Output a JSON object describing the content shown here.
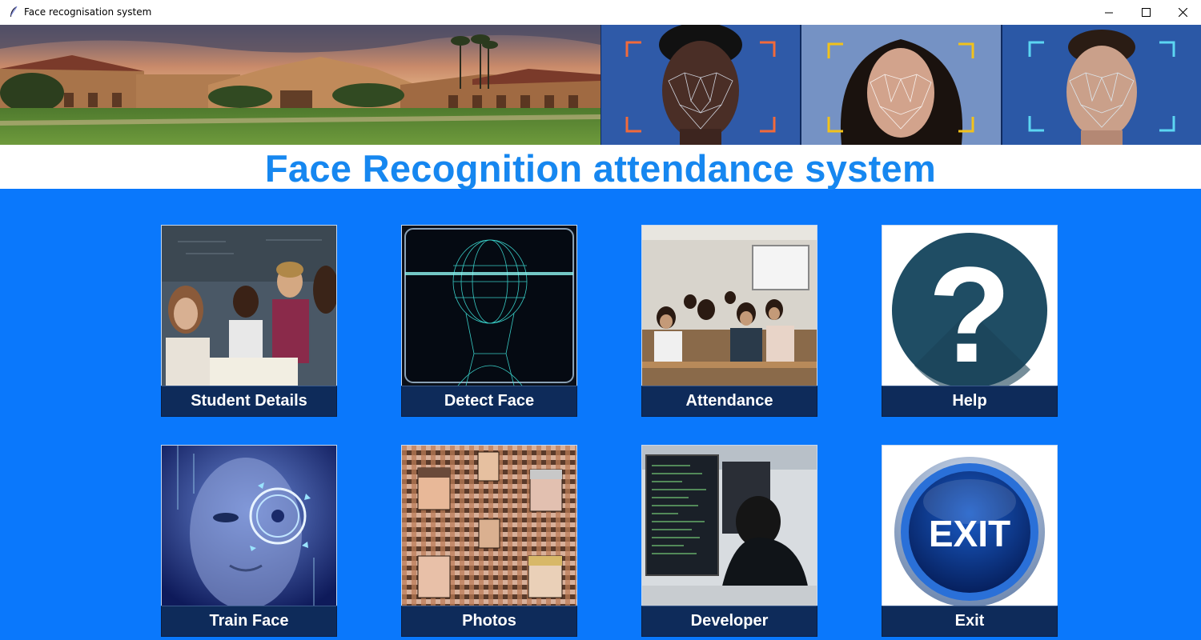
{
  "window": {
    "title": "Face recognisation system"
  },
  "heading": "Face Recognition attendance system",
  "tiles": [
    {
      "label": "Student Details"
    },
    {
      "label": "Detect Face"
    },
    {
      "label": "Attendance"
    },
    {
      "label": "Help"
    },
    {
      "label": "Train Face"
    },
    {
      "label": "Photos"
    },
    {
      "label": "Developer"
    },
    {
      "label": "Exit"
    }
  ],
  "exit_icon_text": "EXIT",
  "help_icon_text": "?",
  "colors": {
    "background": "#0a78fc",
    "heading_text": "#1687f0",
    "label_bg": "#0e2b5a"
  }
}
